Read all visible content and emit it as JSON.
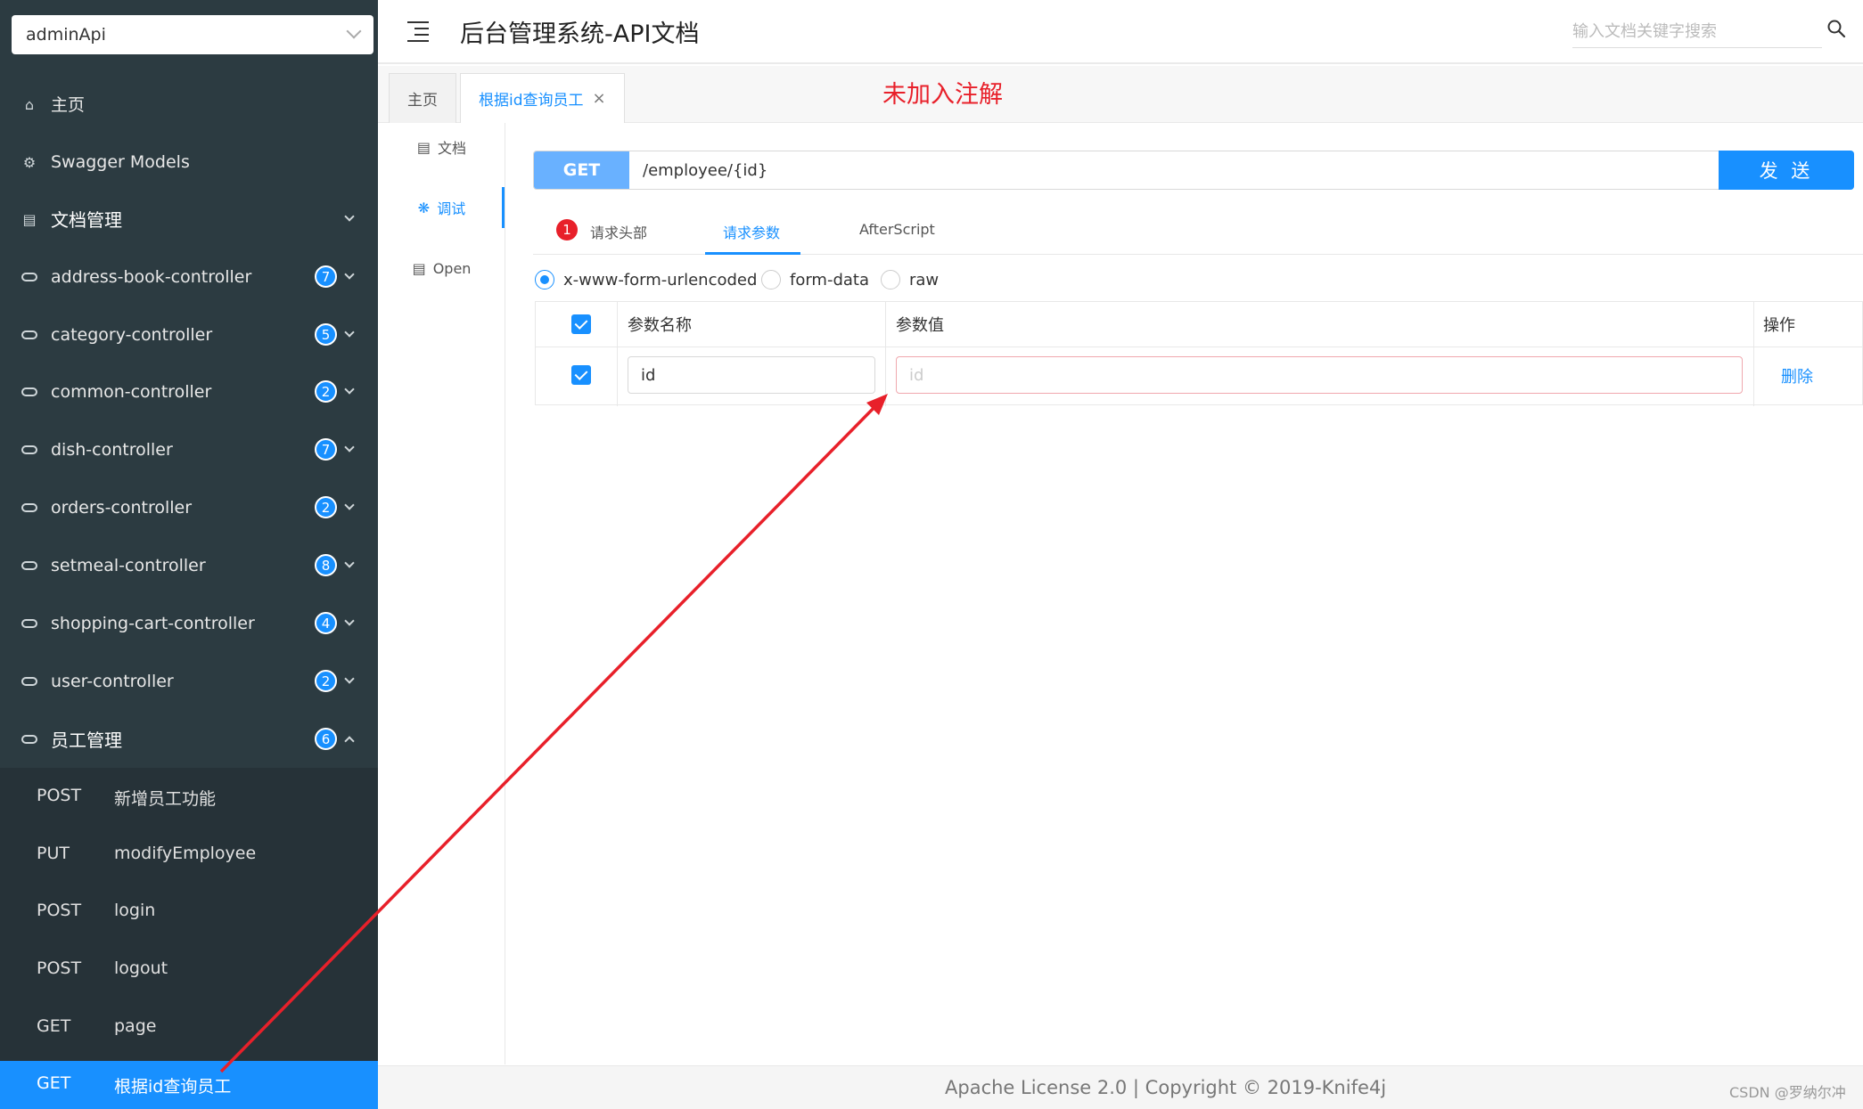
{
  "sidebar": {
    "group_select": "adminApi",
    "items": [
      {
        "label": "主页",
        "icon": "home-icon"
      },
      {
        "label": "Swagger Models",
        "icon": "gear-icon"
      },
      {
        "label": "文档管理",
        "icon": "document-icon"
      },
      {
        "label": "address-book-controller",
        "badge": "7"
      },
      {
        "label": "category-controller",
        "badge": "5"
      },
      {
        "label": "common-controller",
        "badge": "2"
      },
      {
        "label": "dish-controller",
        "badge": "7"
      },
      {
        "label": "orders-controller",
        "badge": "2"
      },
      {
        "label": "setmeal-controller",
        "badge": "8"
      },
      {
        "label": "shopping-cart-controller",
        "badge": "4"
      },
      {
        "label": "user-controller",
        "badge": "2"
      },
      {
        "label": "员工管理",
        "badge": "6"
      }
    ],
    "sub_items": [
      {
        "method": "POST",
        "name": "新增员工功能"
      },
      {
        "method": "PUT",
        "name": "modifyEmployee"
      },
      {
        "method": "POST",
        "name": "login"
      },
      {
        "method": "POST",
        "name": "logout"
      },
      {
        "method": "GET",
        "name": "page"
      },
      {
        "method": "GET",
        "name": "根据id查询员工"
      }
    ]
  },
  "header": {
    "title": "后台管理系统-API文档",
    "search_placeholder": "输入文档关键字搜索"
  },
  "tabs": [
    {
      "label": "主页"
    },
    {
      "label": "根据id查询员工"
    }
  ],
  "annotation": "未加入注解",
  "side_tabs": [
    {
      "label": "文档"
    },
    {
      "label": "调试"
    },
    {
      "label": "Open"
    }
  ],
  "request": {
    "method": "GET",
    "url": "/employee/{id}",
    "send_label": "发 送"
  },
  "request_tabs": {
    "headers": "请求头部",
    "headers_count": "1",
    "params": "请求参数",
    "afterscript": "AfterScript"
  },
  "body_types": [
    "x-www-form-urlencoded",
    "form-data",
    "raw"
  ],
  "param_table": {
    "col_name": "参数名称",
    "col_value": "参数值",
    "col_action": "操作",
    "rows": [
      {
        "name": "id",
        "value_placeholder": "id",
        "action": "删除"
      }
    ]
  },
  "footer": {
    "text": "Apache License 2.0 | Copyright © 2019-Knife4j",
    "watermark": "CSDN @罗纳尔冲"
  },
  "colors": {
    "sidebar_bg": "#2c3b41",
    "submenu_bg": "#263238",
    "accent": "#1890ff",
    "annotation": "#e8202a"
  }
}
